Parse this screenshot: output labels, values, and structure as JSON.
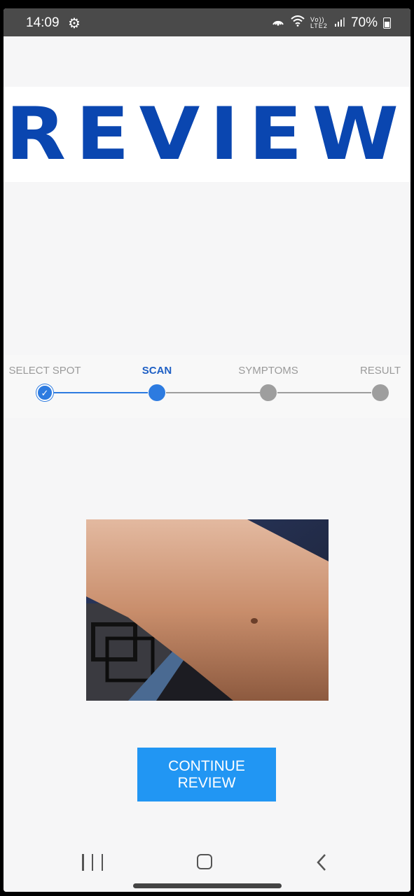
{
  "status_bar": {
    "time": "14:09",
    "battery": "70%",
    "network": "Vo)) LTE2"
  },
  "banner": {
    "text": "REVIEW",
    "color": "#0a46b0"
  },
  "stepper": {
    "steps": [
      {
        "label": "SELECT SPOT",
        "state": "done"
      },
      {
        "label": "SCAN",
        "state": "active"
      },
      {
        "label": "SYMPTOMS",
        "state": "todo"
      },
      {
        "label": "RESULT",
        "state": "todo"
      }
    ],
    "active_color": "#2d7be0",
    "inactive_color": "#9e9e9e"
  },
  "photo": {
    "description_icon": "arm-photo"
  },
  "continue_button": {
    "label": "CONTINUE REVIEW",
    "color": "#2196f3"
  },
  "nav_bar": {
    "recents": "recents-icon",
    "home": "home-icon",
    "back": "back-icon"
  }
}
